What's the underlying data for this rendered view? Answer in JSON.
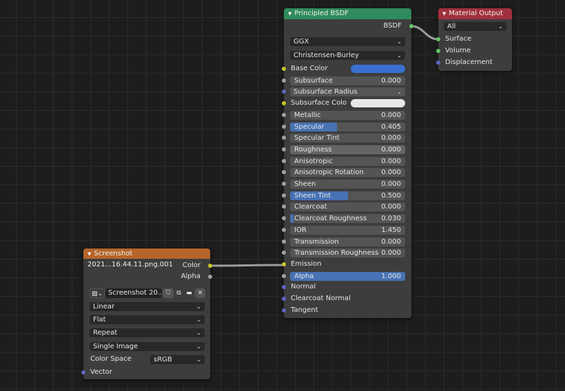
{
  "colors": {
    "shader": "#63c763",
    "color": "#c7c729",
    "float": "#a1a1a1",
    "vector": "#6363c7",
    "bsdf_header": "#2f8a5c",
    "output_header": "#a1303c",
    "texture_header": "#b5652a",
    "accent": "#4772b3"
  },
  "principled": {
    "title": "Principled BSDF",
    "output": "BSDF",
    "distribution": "GGX",
    "subsurface_method": "Christensen-Burley",
    "inputs": [
      {
        "label": "Base Color",
        "type": "color",
        "swatch": "#3b6fd1",
        "socket": "color"
      },
      {
        "label": "Subsurface",
        "type": "slider",
        "value": "0.000",
        "fraction": 0,
        "socket": "float"
      },
      {
        "label": "Subsurface Radius",
        "type": "dropdown",
        "socket": "vector"
      },
      {
        "label": "Subsurface Colo",
        "type": "color",
        "swatch": "#e8e8e8",
        "socket": "color"
      },
      {
        "label": "Metallic",
        "type": "slider",
        "value": "0.000",
        "fraction": 0,
        "socket": "float"
      },
      {
        "label": "Specular",
        "type": "slider",
        "value": "0.405",
        "fraction": 0.405,
        "socket": "float"
      },
      {
        "label": "Specular Tint",
        "type": "slider",
        "value": "0.000",
        "fraction": 0,
        "socket": "float"
      },
      {
        "label": "Roughness",
        "type": "slider",
        "value": "0.000",
        "fraction": 0,
        "socket": "float",
        "hover": true
      },
      {
        "label": "Anisotropic",
        "type": "slider",
        "value": "0.000",
        "fraction": 0,
        "socket": "float"
      },
      {
        "label": "Anisotropic Rotation",
        "type": "slider",
        "value": "0.000",
        "fraction": 0,
        "socket": "float"
      },
      {
        "label": "Sheen",
        "type": "slider",
        "value": "0.000",
        "fraction": 0,
        "socket": "float"
      },
      {
        "label": "Sheen Tint",
        "type": "slider",
        "value": "0.500",
        "fraction": 0.5,
        "socket": "float"
      },
      {
        "label": "Clearcoat",
        "type": "slider",
        "value": "0.000",
        "fraction": 0,
        "socket": "float"
      },
      {
        "label": "Clearcoat Roughness",
        "type": "slider",
        "value": "0.030",
        "fraction": 0.03,
        "socket": "float"
      },
      {
        "label": "IOR",
        "type": "slider",
        "value": "1.450",
        "fraction": 0,
        "socket": "float"
      },
      {
        "label": "Transmission",
        "type": "slider",
        "value": "0.000",
        "fraction": 0,
        "socket": "float"
      },
      {
        "label": "Transmission Roughness",
        "type": "slider",
        "value": "0.000",
        "fraction": 0,
        "socket": "float"
      },
      {
        "label": "Emission",
        "type": "socket",
        "socket": "color"
      },
      {
        "label": "Alpha",
        "type": "slider",
        "value": "1.000",
        "fraction": 1,
        "socket": "float"
      },
      {
        "label": "Normal",
        "type": "socket",
        "socket": "vector"
      },
      {
        "label": "Clearcoat Normal",
        "type": "socket",
        "socket": "vector"
      },
      {
        "label": "Tangent",
        "type": "socket",
        "socket": "vector"
      }
    ]
  },
  "output": {
    "title": "Material Output",
    "target": "All",
    "inputs": [
      "Surface",
      "Volume",
      "Displacement"
    ]
  },
  "image": {
    "title": "Screenshot 2021...16.44.11.png.001",
    "outputs": [
      "Color",
      "Alpha"
    ],
    "image_name": "Screenshot 20...",
    "interpolation": "Linear",
    "projection": "Flat",
    "extension": "Repeat",
    "source": "Single Image",
    "color_space_label": "Color Space",
    "color_space": "sRGB",
    "vector": "Vector"
  }
}
